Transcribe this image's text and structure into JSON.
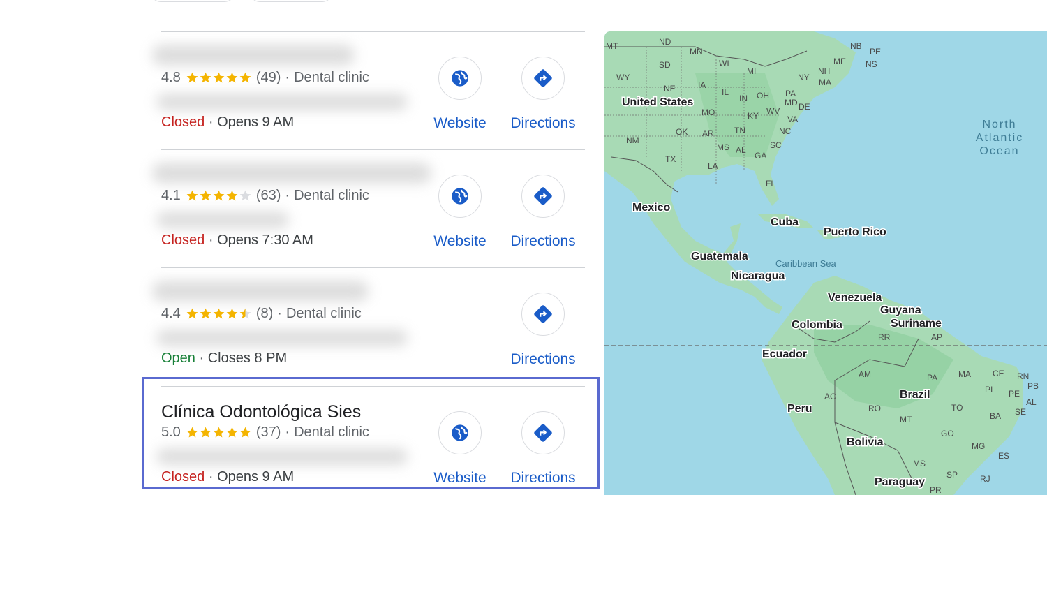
{
  "results": [
    {
      "name": "",
      "rating": "4.8",
      "stars_filled": 5,
      "reviews": "(49)",
      "category": "Dental clinic",
      "status": "Closed",
      "status_type": "closed",
      "hours": "Opens 9 AM",
      "has_website": true
    },
    {
      "name": "",
      "rating": "4.1",
      "stars_filled": 4,
      "reviews": "(63)",
      "category": "Dental clinic",
      "status": "Closed",
      "status_type": "closed",
      "hours": "Opens 7:30 AM",
      "has_website": true
    },
    {
      "name": "",
      "rating": "4.4",
      "stars_filled": 4.5,
      "reviews": "(8)",
      "category": "Dental clinic",
      "status": "Open",
      "status_type": "open",
      "hours": "Closes 8 PM",
      "has_website": false
    },
    {
      "name": "Clínica Odontológica Sies",
      "rating": "5.0",
      "stars_filled": 5,
      "reviews": "(37)",
      "category": "Dental clinic",
      "status": "Closed",
      "status_type": "closed",
      "hours": "Opens 9 AM",
      "has_website": true
    }
  ],
  "actions": {
    "website_label": "Website",
    "directions_label": "Directions"
  },
  "separator": "·",
  "colors": {
    "star": "#f4b400",
    "star_empty": "#dadce0",
    "closed": "#c5221f",
    "open": "#188038",
    "action_blue": "#1a5cc8",
    "highlight": "#5a6ad0",
    "map_water": "#9fd7e7",
    "map_land": "#a8dab5"
  },
  "map": {
    "countries": [
      "United States",
      "Mexico",
      "Cuba",
      "Puerto Rico",
      "Guatemala",
      "Nicaragua",
      "Venezuela",
      "Guyana",
      "Suriname",
      "Colombia",
      "Ecuador",
      "Peru",
      "Brazil",
      "Bolivia",
      "Paraguay"
    ],
    "states": [
      "MT",
      "ND",
      "MN",
      "SD",
      "WY",
      "NE",
      "IA",
      "WI",
      "MI",
      "NB",
      "PE",
      "NS",
      "ME",
      "NH",
      "NY",
      "MA",
      "IL",
      "IN",
      "OH",
      "PA",
      "MD",
      "DE",
      "MO",
      "KY",
      "WV",
      "VA",
      "OK",
      "AR",
      "TN",
      "NC",
      "NM",
      "MS",
      "AL",
      "GA",
      "SC",
      "TX",
      "LA",
      "FL",
      "RR",
      "AP",
      "AM",
      "PA",
      "MA",
      "CE",
      "RN",
      "PB",
      "PI",
      "PE",
      "AL",
      "SE",
      "AC",
      "RO",
      "TO",
      "MT",
      "BA",
      "GO",
      "MG",
      "ES",
      "MS",
      "SP",
      "RJ",
      "PR"
    ],
    "ocean_label": [
      "North",
      "Atlantic",
      "Ocean"
    ],
    "sea_label": "Caribbean Sea"
  }
}
